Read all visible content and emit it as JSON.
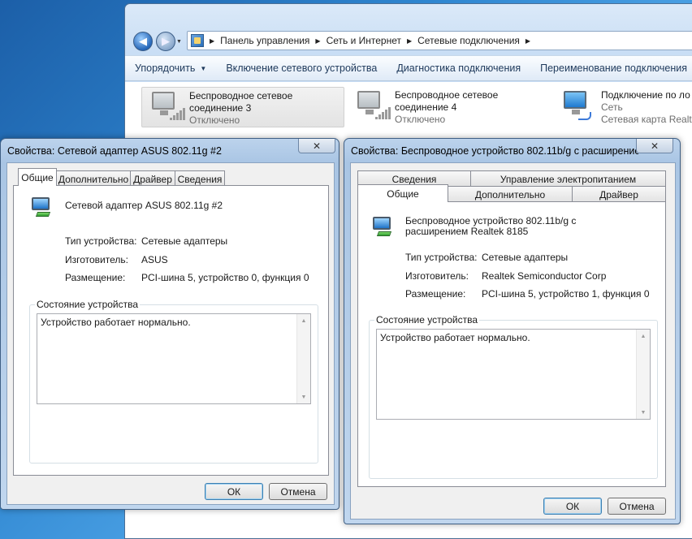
{
  "explorer": {
    "breadcrumb": [
      "Панель управления",
      "Сеть и Интернет",
      "Сетевые подключения"
    ],
    "toolbar": {
      "organize": "Упорядочить",
      "enable": "Включение сетевого устройства",
      "diagnose": "Диагностика подключения",
      "rename": "Переименование подключения"
    },
    "connections": [
      {
        "line1": "Беспроводное сетевое",
        "line2": "соединение 3",
        "status": "Отключено",
        "icon": "wireless-adapter-icon"
      },
      {
        "line1": "Беспроводное сетевое",
        "line2": "соединение 4",
        "status": "Отключено",
        "icon": "wireless-adapter-icon"
      },
      {
        "line1": "Подключение по ло",
        "line2": "Сеть",
        "status": "Сетевая карта Realtek",
        "icon": "wired-adapter-icon"
      }
    ]
  },
  "dialog1": {
    "title": "Свойства: Сетевой адаптер ASUS 802.11g #2",
    "tabs": [
      "Общие",
      "Дополнительно",
      "Драйвер",
      "Сведения"
    ],
    "device_name": "Сетевой адаптер ASUS 802.11g #2",
    "type_label": "Тип устройства:",
    "type_value": "Сетевые адаптеры",
    "maker_label": "Изготовитель:",
    "maker_value": "ASUS",
    "location_label": "Размещение:",
    "location_value": "PCI-шина 5, устройство 0, функция 0",
    "status_group": "Состояние устройства",
    "status_text": "Устройство работает нормально.",
    "ok": "ОК",
    "cancel": "Отмена"
  },
  "dialog2": {
    "title": "Свойства: Беспроводное устройство 802.11b/g с расширение...",
    "tabs_top": [
      "Сведения",
      "Управление электропитанием"
    ],
    "tabs_bottom": [
      "Общие",
      "Дополнительно",
      "Драйвер"
    ],
    "device_name_line1": "Беспроводное устройство 802.11b/g с",
    "device_name_line2": "расширением Realtek 8185",
    "type_label": "Тип устройства:",
    "type_value": "Сетевые адаптеры",
    "maker_label": "Изготовитель:",
    "maker_value": "Realtek Semiconductor Corp",
    "location_label": "Размещение:",
    "location_value": "PCI-шина 5, устройство 1, функция 0",
    "status_group": "Состояние устройства",
    "status_text": "Устройство работает нормально.",
    "ok": "ОК",
    "cancel": "Отмена"
  }
}
